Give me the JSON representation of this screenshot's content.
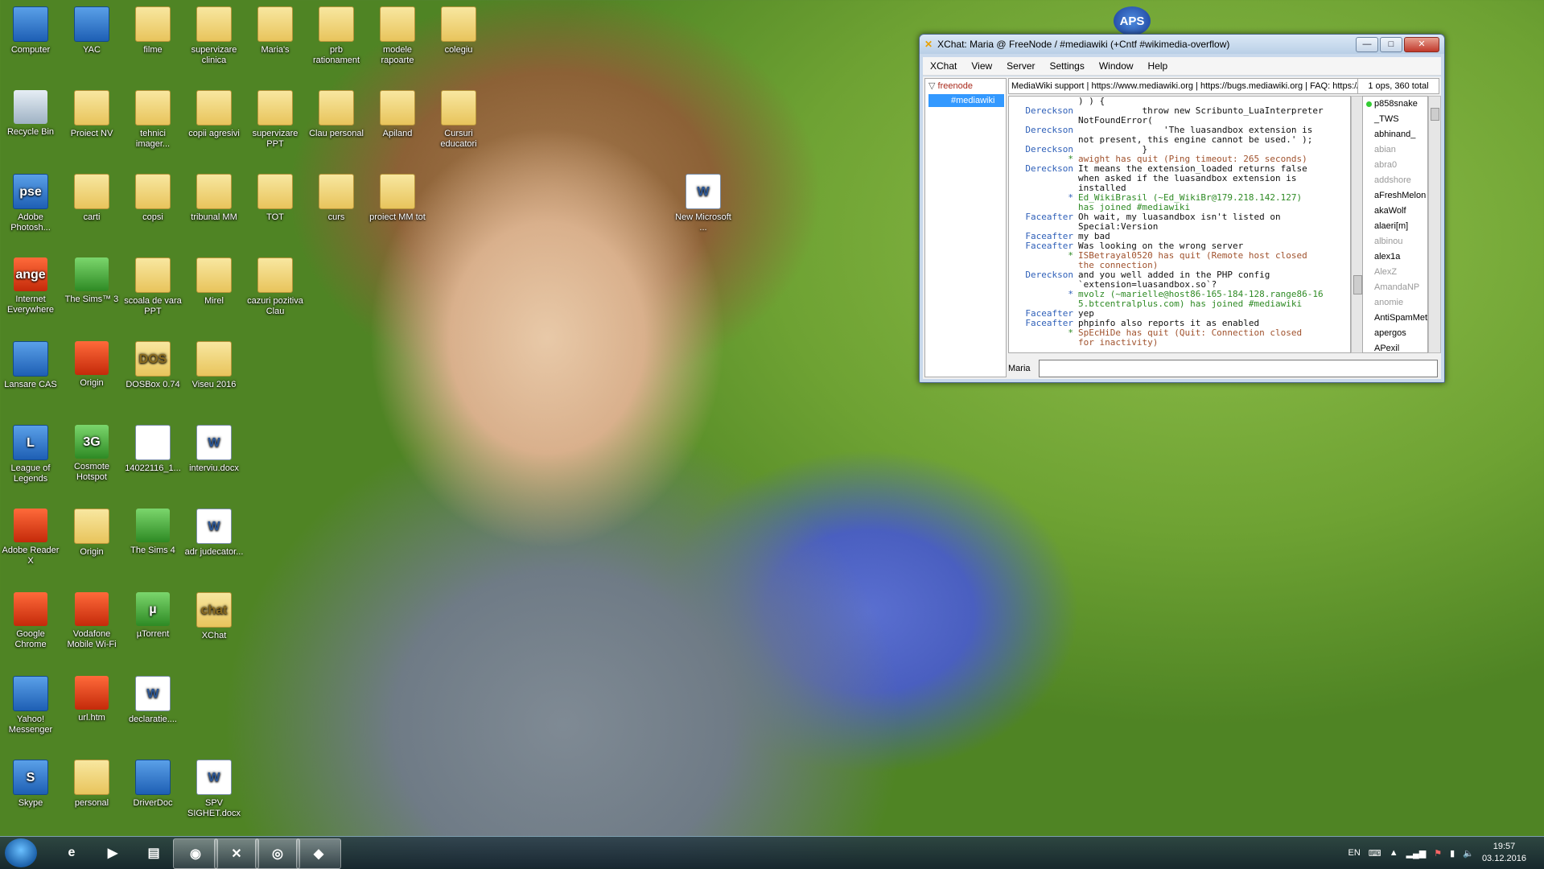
{
  "desktop_icons": [
    {
      "label": "Computer",
      "icon": "computer-icon",
      "kind": "app"
    },
    {
      "label": "YAC",
      "icon": "shield-icon",
      "kind": "app"
    },
    {
      "label": "filme",
      "icon": "folder-icon",
      "kind": "folder"
    },
    {
      "label": "supervizare clinica",
      "icon": "folder-icon",
      "kind": "folder"
    },
    {
      "label": "Maria's",
      "icon": "folder-icon",
      "kind": "folder"
    },
    {
      "label": "prb rationament",
      "icon": "folder-icon",
      "kind": "folder"
    },
    {
      "label": "modele rapoarte",
      "icon": "folder-icon",
      "kind": "folder"
    },
    {
      "label": "colegiu",
      "icon": "folder-icon",
      "kind": "folder"
    },
    {
      "label": "Recycle Bin",
      "icon": "recycle-bin-icon",
      "kind": "trash"
    },
    {
      "label": "Proiect NV",
      "icon": "folder-icon",
      "kind": "folder"
    },
    {
      "label": "tehnici imager...",
      "icon": "folder-icon",
      "kind": "folder"
    },
    {
      "label": "copii agresivi",
      "icon": "folder-icon",
      "kind": "folder"
    },
    {
      "label": "supervizare PPT",
      "icon": "folder-icon",
      "kind": "folder"
    },
    {
      "label": "Clau personal",
      "icon": "folder-icon",
      "kind": "folder"
    },
    {
      "label": "Apiland",
      "icon": "folder-icon",
      "kind": "folder"
    },
    {
      "label": "Cursuri educatori",
      "icon": "folder-icon",
      "kind": "folder"
    },
    {
      "label": "Adobe Photosh...",
      "icon": "photoshop-icon",
      "kind": "app",
      "glyph": "pse"
    },
    {
      "label": "carti",
      "icon": "folder-icon",
      "kind": "folder"
    },
    {
      "label": "copsi",
      "icon": "folder-icon",
      "kind": "folder"
    },
    {
      "label": "tribunal MM",
      "icon": "folder-icon",
      "kind": "folder"
    },
    {
      "label": "TOT",
      "icon": "folder-icon",
      "kind": "folder"
    },
    {
      "label": "curs",
      "icon": "folder-icon",
      "kind": "folder"
    },
    {
      "label": "proiect MM tot",
      "icon": "folder-icon",
      "kind": "folder"
    },
    {
      "label": "New Microsoft ...",
      "icon": "word-document-icon",
      "kind": "doc",
      "glyph": "W"
    },
    {
      "label": "Internet Everywhere",
      "icon": "orange-internet-icon",
      "kind": "red",
      "glyph": "ange"
    },
    {
      "label": "The Sims™ 3",
      "icon": "sims-icon",
      "kind": "green"
    },
    {
      "label": "scoala de vara PPT",
      "icon": "folder-icon",
      "kind": "folder"
    },
    {
      "label": "Mirel",
      "icon": "folder-icon",
      "kind": "folder"
    },
    {
      "label": "cazuri pozitiva Clau",
      "icon": "folder-icon",
      "kind": "folder"
    },
    {
      "label": "Lansare CAS",
      "icon": "cas-icon",
      "kind": "app"
    },
    {
      "label": "Origin",
      "icon": "origin-icon",
      "kind": "red"
    },
    {
      "label": "DOSBox 0.74",
      "icon": "dosbox-icon",
      "kind": "folder",
      "glyph": "DOS"
    },
    {
      "label": "Viseu 2016",
      "icon": "folder-icon",
      "kind": "folder"
    },
    {
      "label": "League of Legends",
      "icon": "league-of-legends-icon",
      "kind": "app",
      "glyph": "L"
    },
    {
      "label": "Cosmote Hotspot",
      "icon": "cosmote-icon",
      "kind": "green",
      "glyph": "3G"
    },
    {
      "label": "14022116_1...",
      "icon": "image-file-icon",
      "kind": "doc"
    },
    {
      "label": "interviu.docx",
      "icon": "word-document-icon",
      "kind": "doc",
      "glyph": "W"
    },
    {
      "label": "Adobe Reader X",
      "icon": "adobe-reader-icon",
      "kind": "red"
    },
    {
      "label": "Origin",
      "icon": "origin-folder-icon",
      "kind": "folder"
    },
    {
      "label": "The Sims 4",
      "icon": "sims-icon",
      "kind": "green"
    },
    {
      "label": "adr judecator...",
      "icon": "word-document-icon",
      "kind": "doc",
      "glyph": "W"
    },
    {
      "label": "Google Chrome",
      "icon": "chrome-icon",
      "kind": "red"
    },
    {
      "label": "Vodafone Mobile Wi-Fi",
      "icon": "vodafone-icon",
      "kind": "red"
    },
    {
      "label": "µTorrent",
      "icon": "utorrent-icon",
      "kind": "green",
      "glyph": "µ"
    },
    {
      "label": "XChat",
      "icon": "xchat-icon",
      "kind": "folder",
      "glyph": "chat"
    },
    {
      "label": "Yahoo! Messenger",
      "icon": "yahoo-messenger-icon",
      "kind": "app"
    },
    {
      "label": "url.htm",
      "icon": "chrome-icon",
      "kind": "red"
    },
    {
      "label": "declaratie....",
      "icon": "word-document-icon",
      "kind": "doc",
      "glyph": "W"
    },
    {
      "label": "Skype",
      "icon": "skype-icon",
      "kind": "app",
      "glyph": "S"
    },
    {
      "label": "personal",
      "icon": "folder-icon",
      "kind": "folder"
    },
    {
      "label": "DriverDoc",
      "icon": "driverdoc-icon",
      "kind": "app"
    },
    {
      "label": "SPV SIGHET.docx",
      "icon": "word-document-icon",
      "kind": "doc",
      "glyph": "W"
    }
  ],
  "aps_logo": "APS",
  "xchat": {
    "title": "XChat: Maria @ FreeNode / #mediawiki (+Cntf #wikimedia-overflow)",
    "menu": [
      "XChat",
      "View",
      "Server",
      "Settings",
      "Window",
      "Help"
    ],
    "network": "freenode",
    "channel": "#mediawiki",
    "topic": "MediaWiki support | https://www.mediawiki.org | https://bugs.mediawiki.org | FAQ: https://",
    "ops_count": "1 ops, 360 total",
    "messages": [
      {
        "nick": "",
        "text": ") ) {",
        "type": "msg"
      },
      {
        "nick": "Dereckson",
        "text": "            throw new Scribunto_LuaInterpreter",
        "type": "msg"
      },
      {
        "nick": "",
        "text": "NotFoundError(",
        "type": "msg"
      },
      {
        "nick": "Dereckson",
        "text": "                'The luasandbox extension is",
        "type": "msg"
      },
      {
        "nick": "",
        "text": "not present, this engine cannot be used.' );",
        "type": "msg"
      },
      {
        "nick": "Dereckson",
        "text": "            }",
        "type": "msg"
      },
      {
        "nick": "*",
        "text": "awight has quit (Ping timeout: 265 seconds)",
        "type": "sys"
      },
      {
        "nick": "Dereckson",
        "text": "It means the extension_loaded returns false",
        "type": "msg"
      },
      {
        "nick": "",
        "text": "when asked if the luasandbox extension is",
        "type": "msg"
      },
      {
        "nick": "",
        "text": "installed",
        "type": "msg"
      },
      {
        "nick": "*",
        "text": "Ed_WikiBrasil (~Ed_WikiBr@179.218.142.127)",
        "type": "join"
      },
      {
        "nick": "",
        "text": "has joined #mediawiki",
        "type": "join"
      },
      {
        "nick": "Faceafter",
        "text": "Oh wait, my luasandbox isn't listed on",
        "type": "msg"
      },
      {
        "nick": "",
        "text": "Special:Version",
        "type": "msg"
      },
      {
        "nick": "Faceafter",
        "text": "my bad",
        "type": "msg"
      },
      {
        "nick": "Faceafter",
        "text": "Was looking on the wrong server",
        "type": "msg"
      },
      {
        "nick": "*",
        "text": "ISBetrayal0520 has quit (Remote host closed",
        "type": "sys"
      },
      {
        "nick": "",
        "text": "the connection)",
        "type": "sys"
      },
      {
        "nick": "Dereckson",
        "text": "and you well added in the PHP config",
        "type": "msg"
      },
      {
        "nick": "",
        "text": "`extension=luasandbox.so`?",
        "type": "msg"
      },
      {
        "nick": "*",
        "text": "mvolz (~marielle@host86-165-184-128.range86-16",
        "type": "join"
      },
      {
        "nick": "",
        "text": "5.btcentralplus.com) has joined #mediawiki",
        "type": "join"
      },
      {
        "nick": "Faceafter",
        "text": "yep",
        "type": "msg"
      },
      {
        "nick": "Faceafter",
        "text": "phpinfo also reports it as enabled",
        "type": "msg"
      },
      {
        "nick": "*",
        "text": "SpEcHiDe has quit (Quit: Connection closed",
        "type": "sys"
      },
      {
        "nick": "",
        "text": "for inactivity)",
        "type": "sys"
      }
    ],
    "users": [
      {
        "name": "p858snake",
        "status": "op"
      },
      {
        "name": "_TWS",
        "status": "here"
      },
      {
        "name": "abhinand_",
        "status": "here"
      },
      {
        "name": "abian",
        "status": "away"
      },
      {
        "name": "abra0",
        "status": "away"
      },
      {
        "name": "addshore",
        "status": "away"
      },
      {
        "name": "aFreshMelon",
        "status": "here"
      },
      {
        "name": "akaWolf",
        "status": "here"
      },
      {
        "name": "alaeri[m]",
        "status": "here"
      },
      {
        "name": "albinou",
        "status": "away"
      },
      {
        "name": "alex1a",
        "status": "here"
      },
      {
        "name": "AlexZ",
        "status": "away"
      },
      {
        "name": "AmandaNP",
        "status": "away"
      },
      {
        "name": "anomie",
        "status": "away"
      },
      {
        "name": "AntiSpamMet",
        "status": "here"
      },
      {
        "name": "apergos",
        "status": "here"
      },
      {
        "name": "APexil",
        "status": "here"
      }
    ],
    "my_nick": "Maria",
    "input_value": ""
  },
  "taskbar": {
    "items": [
      {
        "icon": "internet-explorer-icon",
        "glyph": "e",
        "active": false
      },
      {
        "icon": "media-player-icon",
        "glyph": "▶",
        "active": false
      },
      {
        "icon": "file-explorer-icon",
        "glyph": "▤",
        "active": false
      },
      {
        "icon": "chrome-icon",
        "glyph": "◉",
        "active": true
      },
      {
        "icon": "xchat-icon",
        "glyph": "✕",
        "active": true
      },
      {
        "icon": "origin-icon",
        "glyph": "◎",
        "active": true
      },
      {
        "icon": "sims-icon",
        "glyph": "◆",
        "active": true
      }
    ],
    "language": "EN",
    "time": "19:57",
    "date": "03.12.2016"
  },
  "colors": {
    "accent": "#3399ff",
    "nick": "#2e5fb8",
    "quit": "#a0522d",
    "join": "#2e8a24"
  }
}
